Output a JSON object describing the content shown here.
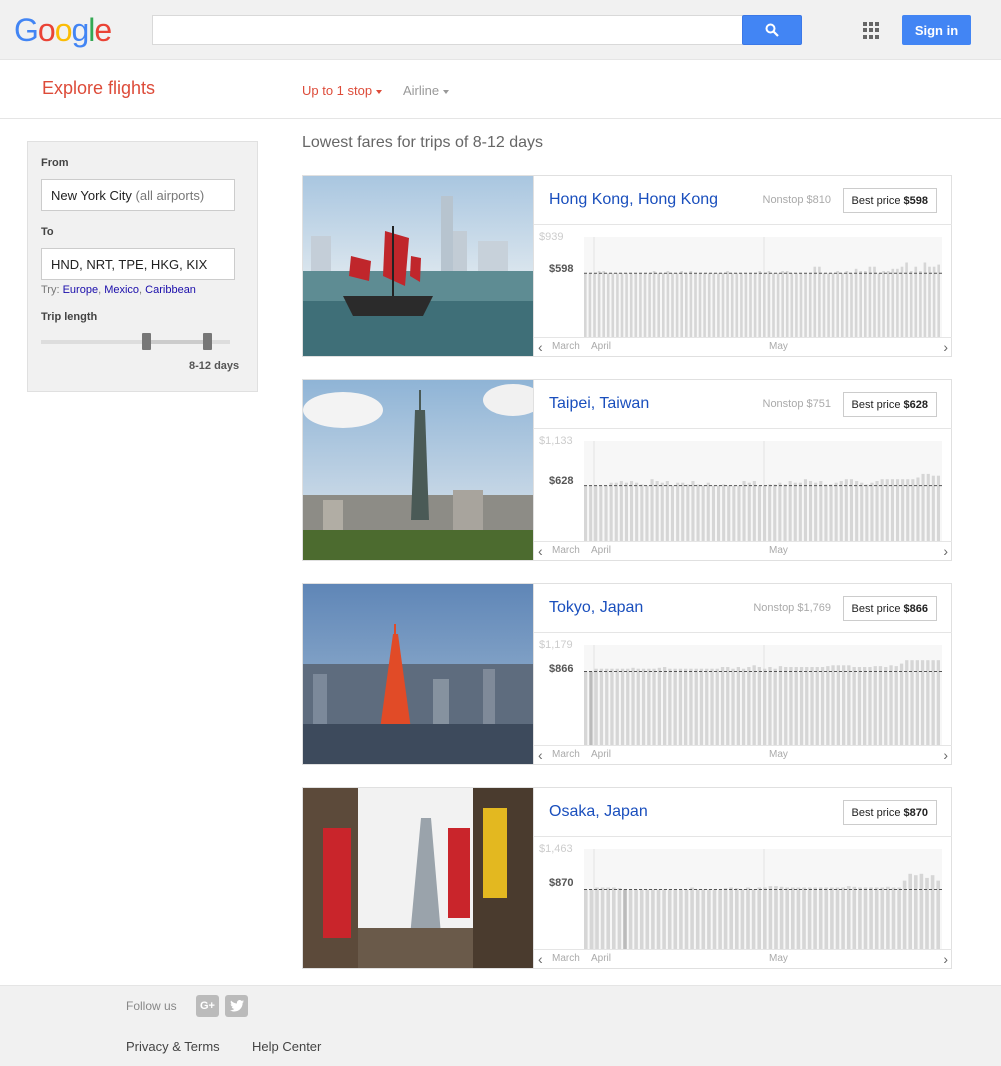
{
  "header": {
    "logo": "Google",
    "search_value": "",
    "signin_label": "Sign in"
  },
  "subheader": {
    "title": "Explore flights",
    "stops_filter": "Up to 1 stop",
    "airline_filter": "Airline"
  },
  "panel": {
    "from_label": "From",
    "from_value": "New York City",
    "from_suffix": "(all airports)",
    "to_label": "To",
    "to_value": "HND, NRT, TPE, HKG, KIX",
    "try_label": "Try:",
    "try_links": [
      "Europe",
      "Mexico",
      "Caribbean"
    ],
    "trip_length_label": "Trip length",
    "trip_length_value": "8-12 days"
  },
  "results": {
    "title": "Lowest fares for trips of 8-12 days",
    "months": [
      "March",
      "April",
      "May"
    ],
    "cards": [
      {
        "city": "Hong Kong, Hong Kong",
        "nonstop": "Nonstop $810",
        "best_label": "Best price",
        "best_price": "$598",
        "axis_max": "$939",
        "axis_best": "$598",
        "max_value": 939,
        "best_value": 598,
        "prices": [
          598,
          598,
          598,
          598,
          598,
          598,
          598,
          598,
          620,
          620,
          598,
          598,
          598,
          598,
          598,
          598,
          598,
          598,
          598,
          598,
          598,
          620,
          598,
          598,
          620,
          598,
          598,
          620,
          598,
          598,
          620,
          598,
          598,
          598,
          598,
          598,
          598,
          598,
          598,
          598,
          598,
          598,
          598,
          598,
          598,
          598,
          598,
          598,
          598,
          598,
          598,
          620,
          620,
          598,
          598,
          598,
          598,
          598,
          598,
          598,
          598,
          598,
          598,
          598,
          598,
          598,
          598,
          598,
          598,
          598,
          598,
          598,
          598,
          598,
          598,
          598,
          598,
          598,
          598,
          598,
          598,
          598,
          598,
          598,
          598,
          598,
          598,
          620,
          620,
          620,
          620,
          620,
          620,
          620,
          620,
          620,
          620,
          620,
          620,
          620,
          620,
          620,
          620,
          620,
          620,
          620,
          620,
          620,
          620,
          620,
          620,
          620,
          620,
          620,
          620,
          620,
          620,
          620,
          620,
          620,
          620,
          620,
          620,
          620,
          620,
          620,
          620,
          620,
          620,
          620,
          620
        ]
      },
      {
        "city": "Taipei, Taiwan",
        "nonstop": "Nonstop $751",
        "best_label": "Best price",
        "best_price": "$628",
        "axis_max": "$1,133",
        "axis_best": "$628",
        "max_value": 1133,
        "best_value": 628,
        "prices": []
      },
      {
        "city": "Tokyo, Japan",
        "nonstop": "Nonstop $1,769",
        "best_label": "Best price",
        "best_price": "$866",
        "axis_max": "$1,179",
        "axis_best": "$866",
        "max_value": 1179,
        "best_value": 866,
        "prices": []
      },
      {
        "city": "Osaka, Japan",
        "nonstop": "",
        "best_label": "Best price",
        "best_price": "$870",
        "axis_max": "$1,463",
        "axis_best": "$870",
        "max_value": 1463,
        "best_value": 870,
        "prices": []
      }
    ]
  },
  "footer": {
    "follow_label": "Follow us",
    "gplus": "G+",
    "twitter": "t",
    "privacy": "Privacy & Terms",
    "help": "Help Center"
  }
}
